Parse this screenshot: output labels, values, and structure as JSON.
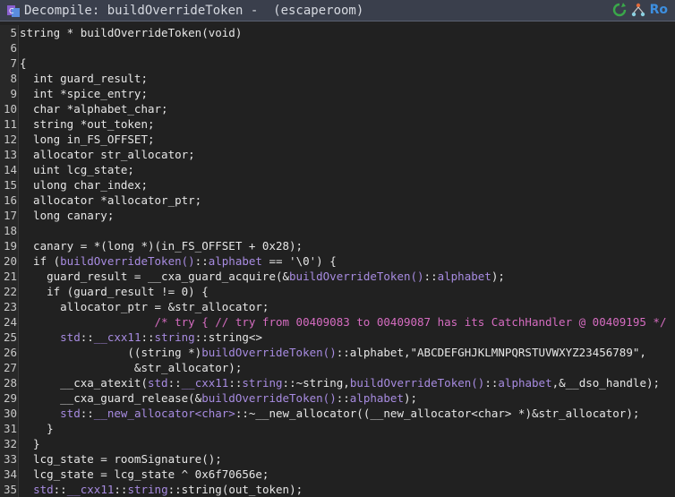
{
  "window": {
    "title": "Decompile: buildOverrideToken -  (escaperoom)",
    "actions": [
      {
        "name": "refresh-icon"
      },
      {
        "name": "graph-icon"
      },
      {
        "name": "ro-toggle",
        "label": "Ro"
      }
    ],
    "colors": {
      "title_bg": "#3a3f4c",
      "code_bg": "#212121",
      "accent": "#3d8fe0",
      "comment": "#d56cc0",
      "namespace": "#a78be0"
    }
  },
  "code": {
    "lines": [
      {
        "n": "5",
        "segs": [
          [
            "plain",
            "string * buildOverrideToken(void)"
          ]
        ]
      },
      {
        "n": "6",
        "segs": []
      },
      {
        "n": "7",
        "segs": [
          [
            "plain",
            "{"
          ]
        ]
      },
      {
        "n": "8",
        "segs": [
          [
            "plain",
            "  int guard_result;"
          ]
        ]
      },
      {
        "n": "9",
        "segs": [
          [
            "plain",
            "  int *spice_entry;"
          ]
        ]
      },
      {
        "n": "10",
        "segs": [
          [
            "plain",
            "  char *alphabet_char;"
          ]
        ]
      },
      {
        "n": "11",
        "segs": [
          [
            "plain",
            "  string *out_token;"
          ]
        ]
      },
      {
        "n": "12",
        "segs": [
          [
            "plain",
            "  long in_FS_OFFSET;"
          ]
        ]
      },
      {
        "n": "13",
        "segs": [
          [
            "plain",
            "  allocator str_allocator;"
          ]
        ]
      },
      {
        "n": "14",
        "segs": [
          [
            "plain",
            "  uint lcg_state;"
          ]
        ]
      },
      {
        "n": "15",
        "segs": [
          [
            "plain",
            "  ulong char_index;"
          ]
        ]
      },
      {
        "n": "16",
        "segs": [
          [
            "plain",
            "  allocator *allocator_ptr;"
          ]
        ]
      },
      {
        "n": "17",
        "segs": [
          [
            "plain",
            "  long canary;"
          ]
        ]
      },
      {
        "n": "18",
        "segs": []
      },
      {
        "n": "19",
        "segs": [
          [
            "plain",
            "  canary = *(long *)(in_FS_OFFSET + 0x28);"
          ]
        ]
      },
      {
        "n": "20",
        "segs": [
          [
            "plain",
            "  if ("
          ],
          [
            "ns",
            "buildOverrideToken()"
          ],
          [
            "plain",
            "::"
          ],
          [
            "ns",
            "alphabet"
          ],
          [
            "plain",
            " == '\\0') {"
          ]
        ]
      },
      {
        "n": "21",
        "segs": [
          [
            "plain",
            "    guard_result = __cxa_guard_acquire(&"
          ],
          [
            "ns",
            "buildOverrideToken()"
          ],
          [
            "plain",
            "::"
          ],
          [
            "ns",
            "alphabet"
          ],
          [
            "plain",
            ");"
          ]
        ]
      },
      {
        "n": "22",
        "segs": [
          [
            "plain",
            "    if (guard_result != 0) {"
          ]
        ]
      },
      {
        "n": "23",
        "segs": [
          [
            "plain",
            "      allocator_ptr = &str_allocator;"
          ]
        ]
      },
      {
        "n": "24",
        "segs": [
          [
            "plain",
            "                    "
          ],
          [
            "cm",
            "/* try { // try from 00409083 to 00409087 has its CatchHandler @ 00409195 */"
          ]
        ]
      },
      {
        "n": "25",
        "segs": [
          [
            "plain",
            "      "
          ],
          [
            "ns",
            "std"
          ],
          [
            "plain",
            "::"
          ],
          [
            "ns",
            "__cxx11"
          ],
          [
            "plain",
            "::"
          ],
          [
            "ns",
            "string"
          ],
          [
            "plain",
            "::"
          ],
          [
            "plain",
            "string<>"
          ]
        ]
      },
      {
        "n": "26",
        "segs": [
          [
            "plain",
            "                ((string *)"
          ],
          [
            "ns",
            "buildOverrideToken()"
          ],
          [
            "plain",
            "::alphabet,\"ABCDEFGHJKLMNPQRSTUVWXYZ23456789\","
          ]
        ]
      },
      {
        "n": "27",
        "segs": [
          [
            "plain",
            "                 &str_allocator);"
          ]
        ]
      },
      {
        "n": "28",
        "segs": [
          [
            "plain",
            "      __cxa_atexit("
          ],
          [
            "ns",
            "std"
          ],
          [
            "plain",
            "::"
          ],
          [
            "ns",
            "__cxx11"
          ],
          [
            "plain",
            "::"
          ],
          [
            "ns",
            "string"
          ],
          [
            "plain",
            "::~string,"
          ],
          [
            "ns",
            "buildOverrideToken()"
          ],
          [
            "plain",
            "::"
          ],
          [
            "ns",
            "alphabet"
          ],
          [
            "plain",
            ",&__dso_handle);"
          ]
        ]
      },
      {
        "n": "29",
        "segs": [
          [
            "plain",
            "      __cxa_guard_release(&"
          ],
          [
            "ns",
            "buildOverrideToken()"
          ],
          [
            "plain",
            "::"
          ],
          [
            "ns",
            "alphabet"
          ],
          [
            "plain",
            ");"
          ]
        ]
      },
      {
        "n": "30",
        "segs": [
          [
            "plain",
            "      "
          ],
          [
            "ns",
            "std"
          ],
          [
            "plain",
            "::"
          ],
          [
            "ns",
            "__new_allocator<char>"
          ],
          [
            "plain",
            "::~__new_allocator((__new_allocator<char> *)&str_allocator);"
          ]
        ]
      },
      {
        "n": "31",
        "segs": [
          [
            "plain",
            "    }"
          ]
        ]
      },
      {
        "n": "32",
        "segs": [
          [
            "plain",
            "  }"
          ]
        ]
      },
      {
        "n": "33",
        "segs": [
          [
            "plain",
            "  lcg_state = roomSignature();"
          ]
        ]
      },
      {
        "n": "34",
        "segs": [
          [
            "plain",
            "  lcg_state = lcg_state ^ 0x6f70656e;"
          ]
        ]
      },
      {
        "n": "35",
        "segs": [
          [
            "plain",
            "  "
          ],
          [
            "ns",
            "std"
          ],
          [
            "plain",
            "::"
          ],
          [
            "ns",
            "__cxx11"
          ],
          [
            "plain",
            "::"
          ],
          [
            "ns",
            "string"
          ],
          [
            "plain",
            "::string(out_token);"
          ]
        ]
      }
    ]
  }
}
